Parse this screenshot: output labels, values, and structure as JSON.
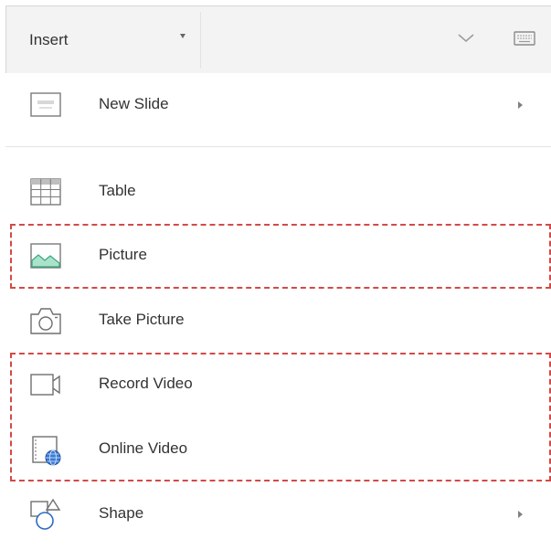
{
  "ribbon": {
    "tab_label": "Insert"
  },
  "icons": {
    "tab_dropdown": "caret-down-icon",
    "collapse": "chevron-down-icon",
    "keyboard": "keyboard-icon",
    "submenu": "caret-right-icon"
  },
  "menu": {
    "items": [
      {
        "label": "New Slide",
        "icon": "new-slide-icon",
        "has_submenu": true
      },
      {
        "label": "Table",
        "icon": "table-icon",
        "has_submenu": false
      },
      {
        "label": "Picture",
        "icon": "picture-icon",
        "has_submenu": false
      },
      {
        "label": "Take Picture",
        "icon": "camera-icon",
        "has_submenu": false
      },
      {
        "label": "Record Video",
        "icon": "video-camera-icon",
        "has_submenu": false
      },
      {
        "label": "Online Video",
        "icon": "online-video-icon",
        "has_submenu": false
      },
      {
        "label": "Shape",
        "icon": "shapes-icon",
        "has_submenu": true
      }
    ]
  },
  "colors": {
    "header_bg": "#f3f3f3",
    "highlight_dash": "#d24a47",
    "picture_icon_green": "#7fd0b0",
    "online_video_blue": "#2b6cc4"
  }
}
